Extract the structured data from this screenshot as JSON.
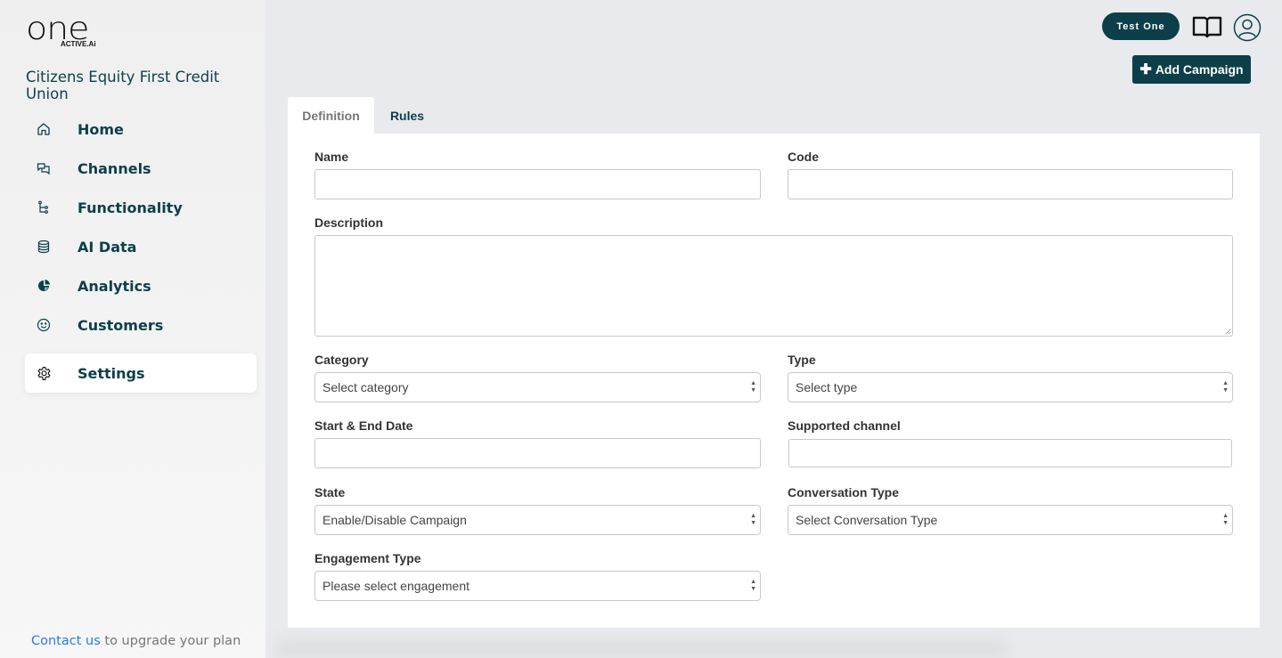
{
  "brand": {
    "logo_main": "one",
    "logo_sub": "ACTIVE.Ai",
    "org_name": "Citizens Equity First Credit Union"
  },
  "sidebar": {
    "items": [
      {
        "label": "Home",
        "icon": "home-icon"
      },
      {
        "label": "Channels",
        "icon": "chat-bubbles-icon"
      },
      {
        "label": "Functionality",
        "icon": "flow-tree-icon"
      },
      {
        "label": "AI Data",
        "icon": "database-icon"
      },
      {
        "label": "Analytics",
        "icon": "pie-chart-icon"
      },
      {
        "label": "Customers",
        "icon": "smiley-icon"
      },
      {
        "label": "Settings",
        "icon": "gear-icon",
        "active": true
      }
    ],
    "footer": {
      "link": "Contact us",
      "text": " to upgrade your plan"
    }
  },
  "header": {
    "user_label": "Test One",
    "add_button": "Add Campaign"
  },
  "tabs": [
    {
      "label": "Definition",
      "active": true
    },
    {
      "label": "Rules"
    }
  ],
  "form": {
    "name": {
      "label": "Name",
      "value": ""
    },
    "code": {
      "label": "Code",
      "value": ""
    },
    "description": {
      "label": "Description",
      "value": ""
    },
    "category": {
      "label": "Category",
      "selected": "Select category"
    },
    "type": {
      "label": "Type",
      "selected": "Select type"
    },
    "dates": {
      "label": "Start & End Date",
      "value": ""
    },
    "channel": {
      "label": "Supported channel",
      "value": ""
    },
    "state": {
      "label": "State",
      "selected": "Enable/Disable Campaign"
    },
    "conversation_type": {
      "label": "Conversation Type",
      "selected": "Select Conversation Type"
    },
    "engagement_type": {
      "label": "Engagement Type",
      "selected": "Please select engagement"
    }
  },
  "colors": {
    "primary": "#0c3f4a",
    "link": "#2a7ae2"
  }
}
